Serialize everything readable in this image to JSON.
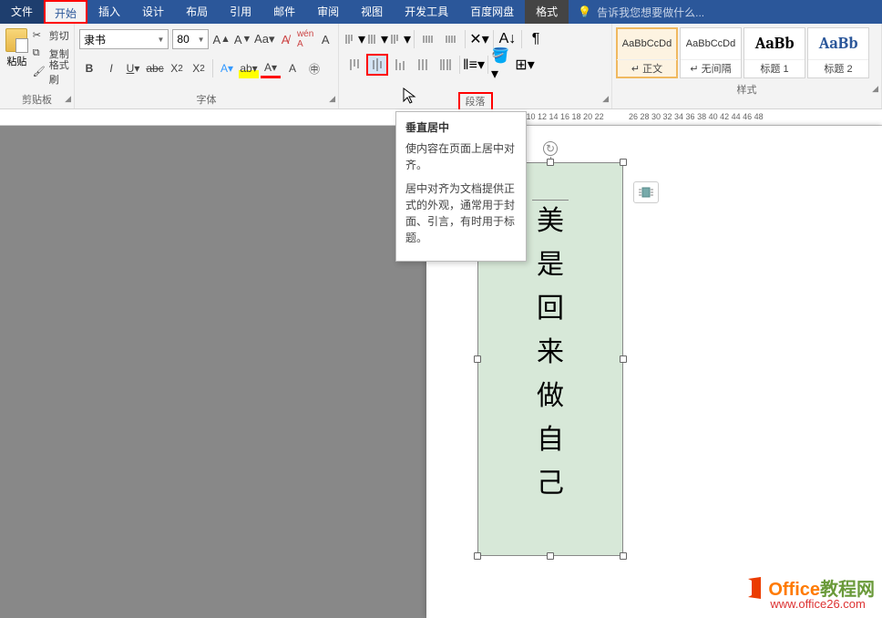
{
  "menu": {
    "file": "文件",
    "home": "开始",
    "insert": "插入",
    "design": "设计",
    "layout": "布局",
    "references": "引用",
    "mailings": "邮件",
    "review": "审阅",
    "view": "视图",
    "developer": "开发工具",
    "baidu": "百度网盘",
    "format": "格式",
    "tellme": "告诉我您想要做什么..."
  },
  "clipboard": {
    "paste": "粘贴",
    "cut": "剪切",
    "copy": "复制",
    "painter": "格式刷",
    "label": "剪贴板"
  },
  "font": {
    "name": "隶书",
    "size": "80",
    "label": "字体"
  },
  "paragraph": {
    "label": "段落"
  },
  "styles": {
    "s1_prev": "AaBbCcDd",
    "s1_name": "↵ 正文",
    "s2_prev": "AaBbCcDd",
    "s2_name": "↵ 无间隔",
    "s3_prev": "AaBb",
    "s3_name": "标题 1",
    "s4_prev": "AaBb",
    "s4_name": "标题 2",
    "label": "样式"
  },
  "tooltip": {
    "title": "垂直居中",
    "line1": "使内容在页面上居中对齐。",
    "line2": "居中对齐为文档提供正式的外观，通常用于封面、引言，有时用于标题。"
  },
  "textbox": {
    "chars": [
      "美",
      "是",
      "回",
      "来",
      "做",
      "自",
      "己"
    ]
  },
  "ruler": {
    "left": "8 10 12 14 16 18 20 22",
    "right": "26 28 30 32 34 36 38 40 42 44 46 48"
  },
  "watermark": {
    "brand1": "Office",
    "brand2": "教程网",
    "url": "www.office26.com"
  }
}
